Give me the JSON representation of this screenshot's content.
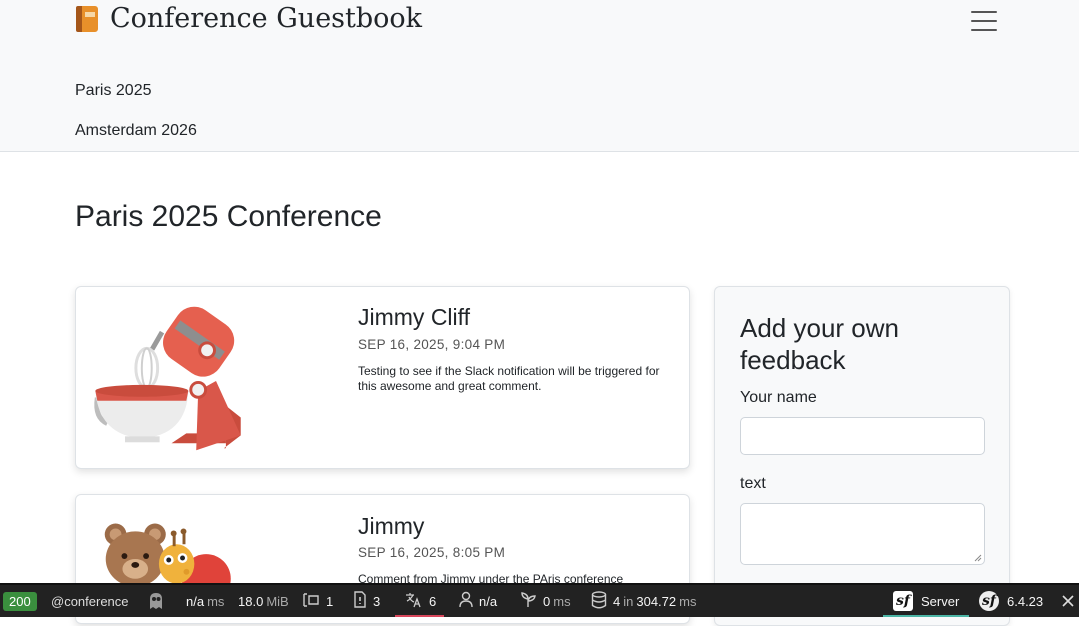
{
  "header": {
    "brand": "Conference Guestbook",
    "brand_icon": "book-icon",
    "menu_icon": "hamburger-icon",
    "nav": [
      "Paris 2025",
      "Amsterdam 2026"
    ]
  },
  "main": {
    "title": "Paris 2025 Conference",
    "comments": [
      {
        "author": "Jimmy Cliff",
        "date": "SEP 16, 2025, 9:04 PM",
        "text": "Testing to see if the Slack notification will be triggered for this awesome and great comment.",
        "image": "stand-mixer-illustration"
      },
      {
        "author": "Jimmy",
        "date": "SEP 16, 2025, 8:05 PM",
        "text": "Comment from Jimmy under the PAris conference",
        "image": "teddy-bear-and-toys-illustration"
      }
    ]
  },
  "form": {
    "title": "Add your own feedback",
    "name_label": "Your name",
    "name_value": "",
    "text_label": "text",
    "text_value": ""
  },
  "toolbar": {
    "status": "200",
    "route": "@conference",
    "time_value": "n/a",
    "time_unit": "ms",
    "memory_value": "18.0",
    "memory_unit": "MiB",
    "forms_count": "1",
    "validator_count": "3",
    "translation_count": "6",
    "user": "n/a",
    "events_value": "0",
    "events_unit": "ms",
    "db_queries": "4",
    "db_in": "in",
    "db_time": "304.72",
    "db_unit": "ms",
    "server_label": "Server",
    "version": "6.4.23",
    "colors": {
      "status_ok": "#3a8f3e",
      "bar_bg": "#222222",
      "translation_accent": "#d9475c",
      "server_accent": "#4bb5a5"
    }
  }
}
